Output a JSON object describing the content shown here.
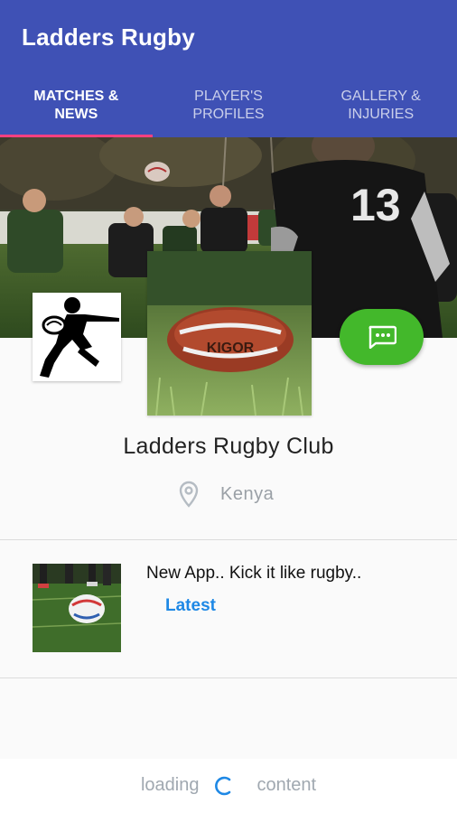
{
  "app_bar": {
    "title": "Ladders Rugby"
  },
  "tabs": [
    {
      "label": "Matches & News",
      "active": true
    },
    {
      "label": "Player's Profiles",
      "active": false
    },
    {
      "label": "Gallery & Injuries",
      "active": false
    }
  ],
  "cover": {
    "jersey_number": "13"
  },
  "profile": {
    "club_name": "Ladders Rugby Club",
    "location": "Kenya",
    "ball_brand": "KIGOR"
  },
  "news": [
    {
      "title": "New App.. Kick it like rugby..",
      "tag": "Latest"
    }
  ],
  "footer": {
    "loading_left": "loading",
    "loading_right": "content"
  },
  "colors": {
    "app_bar": "#3f51b5",
    "tab_indicator": "#ff4081",
    "fab": "#43b82b",
    "tag": "#1e88e5"
  },
  "icons": {
    "fab": "chat-bubble-icon",
    "location": "location-pin-icon",
    "loading": "spinner-icon"
  }
}
